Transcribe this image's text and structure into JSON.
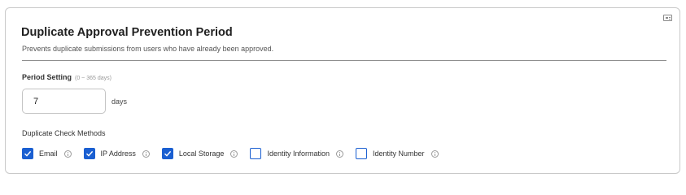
{
  "section": {
    "title": "Duplicate Approval Prevention Period",
    "subtitle": "Prevents duplicate submissions from users who have already been approved."
  },
  "period": {
    "label": "Period Setting",
    "range_hint": "(0 ~ 365 days)",
    "value": "7",
    "unit": "days"
  },
  "methods": {
    "label": "Duplicate Check Methods",
    "items": [
      {
        "label": "Email",
        "checked": true
      },
      {
        "label": "IP Address",
        "checked": true
      },
      {
        "label": "Local Storage",
        "checked": true
      },
      {
        "label": "Identity Information",
        "checked": false
      },
      {
        "label": "Identity Number",
        "checked": false
      }
    ]
  },
  "colors": {
    "accent": "#1a5fd1",
    "border": "#c9c9c9",
    "divider": "#8f8f8f"
  },
  "icons": {
    "corner": "card-details-icon",
    "info": "info-icon",
    "check": "checkmark-icon"
  }
}
